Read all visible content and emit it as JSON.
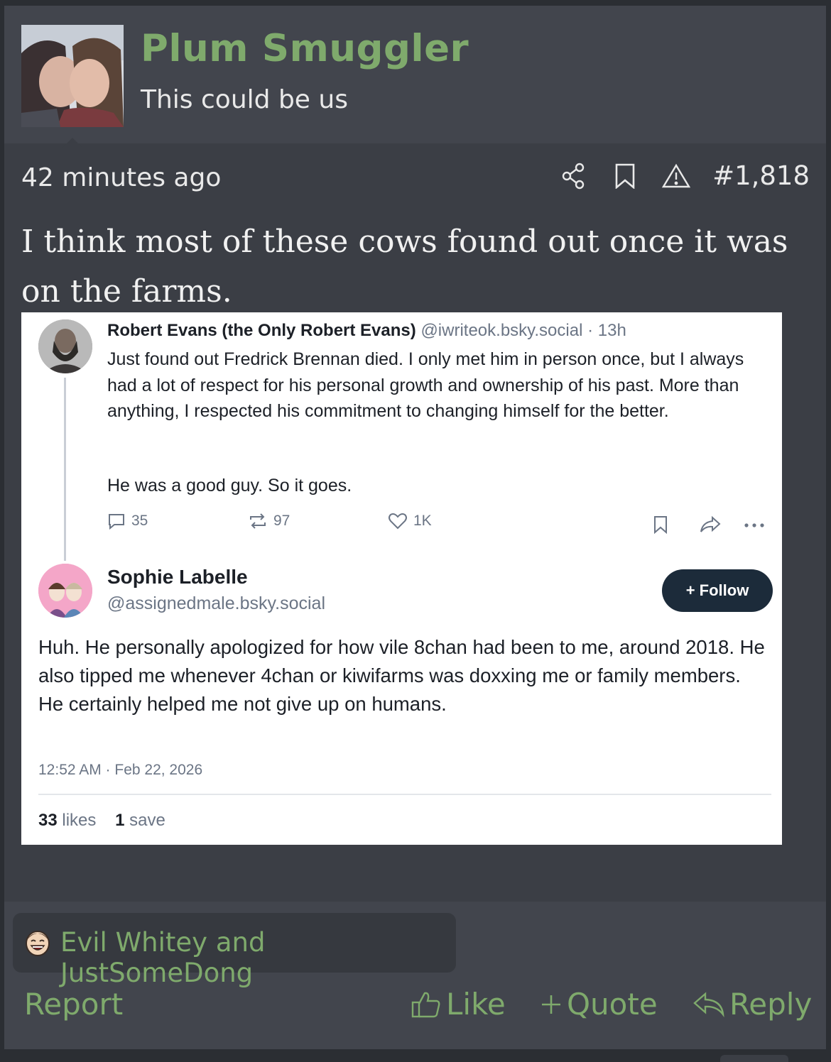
{
  "post": {
    "username": "Plum Smuggler",
    "user_title": "This could be us",
    "timestamp": "42 minutes ago",
    "post_number": "#1,818",
    "body": "I think most of these cows found out once it was on the farms."
  },
  "screenshot": {
    "reply_to": {
      "author": "Robert Evans (the Only Robert Evans)",
      "handle": "@iwriteok.bsky.social",
      "time": "· 13h",
      "text": "Just found out Fredrick Brennan died. I only met him in person once, but I always had a lot of respect for his personal growth and ownership of his past. More than anything, I respected his commitment to changing himself for the better.",
      "text2": "He was a good guy. So it goes.",
      "replies": "35",
      "reposts": "97",
      "likes": "1K"
    },
    "main": {
      "author": "Sophie Labelle",
      "handle": "@assignedmale.bsky.social",
      "follow_label": "+ Follow",
      "text": "Huh. He personally apologized for how vile 8chan had been to me, around 2018. He also tipped me whenever 4chan or kiwifarms was doxxing me or family members. He certainly helped me not give up on humans.",
      "time": "12:52 AM · Feb 22, 2026",
      "likes_count": "33",
      "likes_label": "likes",
      "saves_count": "1",
      "saves_label": "save"
    }
  },
  "reactions": {
    "names": "Evil Whitey and JustSomeDong",
    "icon": "laughing-face-icon"
  },
  "actions": {
    "report": "Report",
    "like": "Like",
    "quote": "Quote",
    "reply": "Reply"
  },
  "colors": {
    "accent": "#7faa6c",
    "background": "#3b3e45",
    "header": "#42454d",
    "text": "#e9e9e9"
  }
}
